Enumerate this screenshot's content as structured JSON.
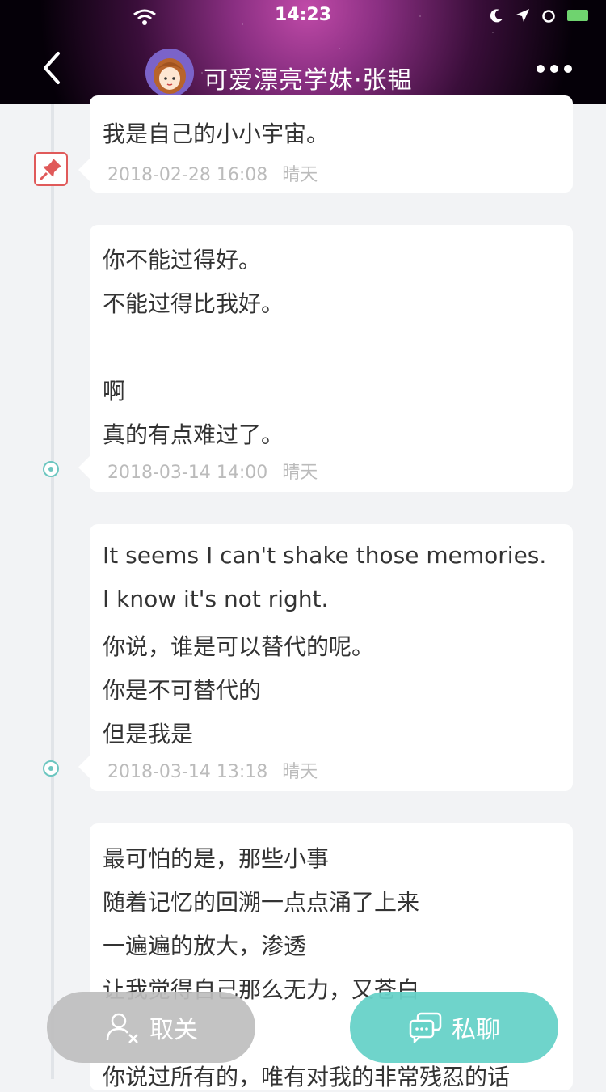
{
  "status": {
    "time": "14:23"
  },
  "header": {
    "title": "可爱漂亮学妹·张韫"
  },
  "posts": [
    {
      "lines": [
        "我是自己的小小宇宙。"
      ],
      "date": "2018-02-28 16:08",
      "weather": "晴天",
      "pinned": true
    },
    {
      "lines": [
        "你不能过得好。",
        "不能过得比我好。",
        "",
        "啊",
        "真的有点难过了。"
      ],
      "date": "2018-03-14 14:00",
      "weather": "晴天"
    },
    {
      "lines": [
        "It seems I can't shake those memories.",
        "I know it's not right.",
        "你说，谁是可以替代的呢。",
        "你是不可替代的",
        "但是我是"
      ],
      "date": "2018-03-14 13:18",
      "weather": "晴天"
    },
    {
      "lines": [
        "最可怕的是，那些小事",
        "随着记忆的回溯一点点涌了上来",
        "一遍遍的放大，渗透",
        "让我觉得自己那么无力，又苍白",
        "",
        "你说过所有的，唯有对我的非常残忍的话"
      ]
    }
  ],
  "buttons": {
    "unfollow": "取关",
    "chat": "私聊"
  },
  "colors": {
    "accent": "#67d2c8",
    "pin": "#e05a5a"
  }
}
